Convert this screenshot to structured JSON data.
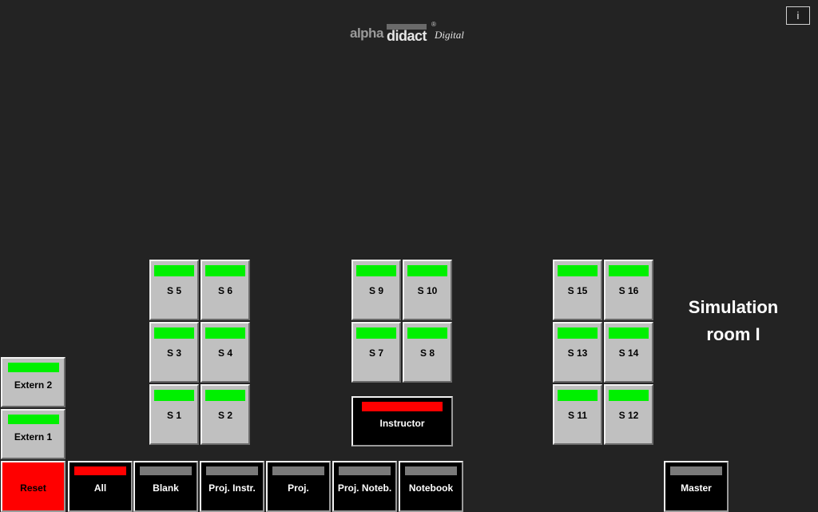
{
  "logo": {
    "alpha": "alpha",
    "didact": "didact",
    "reg": "®",
    "digital": "Digital"
  },
  "info_button": "i",
  "room_title_line1": "Simulation",
  "room_title_line2": "room I",
  "colors": {
    "background": "#232323",
    "indicator_on": "#00f000",
    "indicator_alert": "#ff0000",
    "indicator_off": "#7a7a7a",
    "tile": "#c0c0c0"
  },
  "stations": {
    "s5": "S 5",
    "s6": "S 6",
    "s3": "S 3",
    "s4": "S 4",
    "s1": "S 1",
    "s2": "S 2",
    "s9": "S 9",
    "s10": "S 10",
    "s7": "S 7",
    "s8": "S 8",
    "s15": "S 15",
    "s16": "S 16",
    "s13": "S 13",
    "s14": "S 14",
    "s11": "S 11",
    "s12": "S 12"
  },
  "instructor": "Instructor",
  "extern": {
    "extern2": "Extern 2",
    "extern1": "Extern 1"
  },
  "bottom": {
    "reset": "Reset",
    "all": "All",
    "blank": "Blank",
    "proj_instr": "Proj. Instr.",
    "proj": "Proj.",
    "proj_noteb": "Proj. Noteb.",
    "notebook": "Notebook",
    "master": "Master"
  }
}
